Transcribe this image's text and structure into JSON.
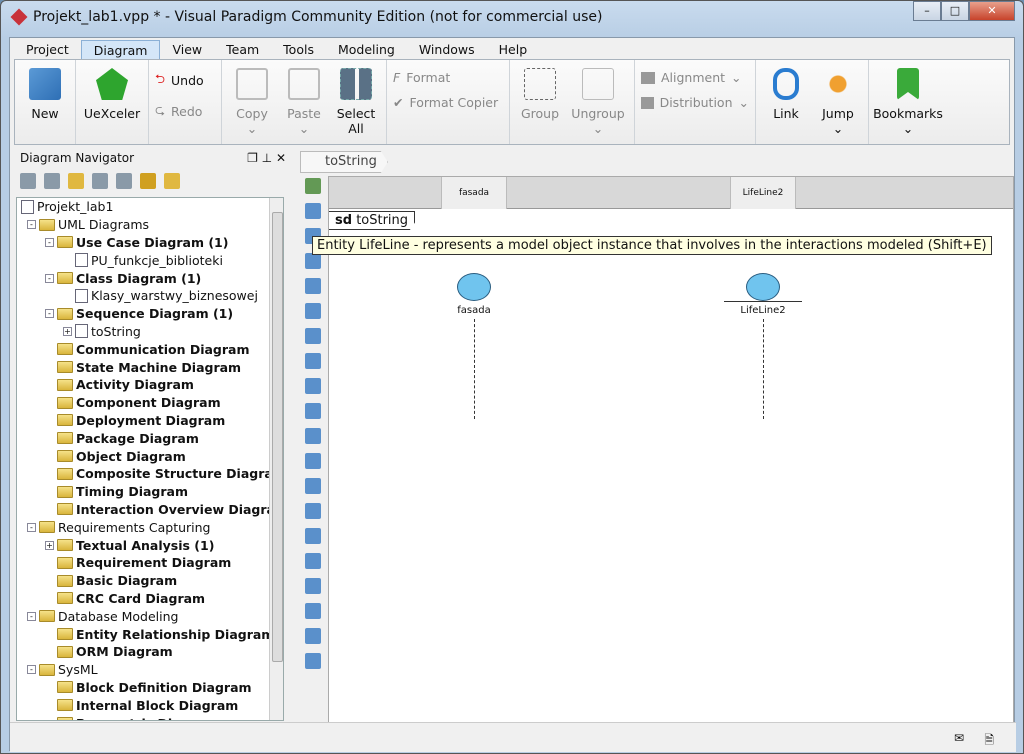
{
  "window": {
    "title": "Projekt_lab1.vpp * - Visual Paradigm Community Edition (not for commercial use)",
    "min": "–",
    "max": "□",
    "close": "✕"
  },
  "menu": [
    "Project",
    "Diagram",
    "View",
    "Team",
    "Tools",
    "Modeling",
    "Windows",
    "Help"
  ],
  "menu_active": "Diagram",
  "ribbon": {
    "new": "New",
    "uexceler": "UeXceler",
    "undo": "Undo",
    "redo": "Redo",
    "copy": "Copy",
    "paste": "Paste",
    "select_all": "Select All",
    "format": "Format",
    "format_copier": "Format Copier",
    "group": "Group",
    "ungroup": "Ungroup",
    "alignment": "Alignment",
    "distribution": "Distribution",
    "link": "Link",
    "jump": "Jump",
    "bookmarks": "Bookmarks"
  },
  "navigator": {
    "title": "Diagram Navigator",
    "tree": [
      {
        "label": "Projekt_lab1",
        "level": 0,
        "icon": "doc"
      },
      {
        "label": "UML Diagrams",
        "level": 1,
        "exp": "-"
      },
      {
        "label": "Use Case Diagram (1)",
        "level": 2,
        "bold": true,
        "exp": "-"
      },
      {
        "label": "PU_funkcje_biblioteki",
        "level": 3,
        "icon": "doc"
      },
      {
        "label": "Class Diagram (1)",
        "level": 2,
        "bold": true,
        "exp": "-"
      },
      {
        "label": "Klasy_warstwy_biznesowej",
        "level": 3,
        "icon": "doc"
      },
      {
        "label": "Sequence Diagram (1)",
        "level": 2,
        "bold": true,
        "exp": "-"
      },
      {
        "label": "toString",
        "level": 3,
        "icon": "doc",
        "exp": "+"
      },
      {
        "label": "Communication Diagram",
        "level": 2,
        "bold": true
      },
      {
        "label": "State Machine Diagram",
        "level": 2,
        "bold": true
      },
      {
        "label": "Activity Diagram",
        "level": 2,
        "bold": true
      },
      {
        "label": "Component Diagram",
        "level": 2,
        "bold": true
      },
      {
        "label": "Deployment Diagram",
        "level": 2,
        "bold": true
      },
      {
        "label": "Package Diagram",
        "level": 2,
        "bold": true
      },
      {
        "label": "Object Diagram",
        "level": 2,
        "bold": true
      },
      {
        "label": "Composite Structure Diagram",
        "level": 2,
        "bold": true
      },
      {
        "label": "Timing Diagram",
        "level": 2,
        "bold": true
      },
      {
        "label": "Interaction Overview Diagram",
        "level": 2,
        "bold": true
      },
      {
        "label": "Requirements Capturing",
        "level": 1,
        "exp": "-"
      },
      {
        "label": "Textual Analysis (1)",
        "level": 2,
        "bold": true,
        "exp": "+"
      },
      {
        "label": "Requirement Diagram",
        "level": 2,
        "bold": true
      },
      {
        "label": "Basic Diagram",
        "level": 2,
        "bold": true
      },
      {
        "label": "CRC Card Diagram",
        "level": 2,
        "bold": true
      },
      {
        "label": "Database Modeling",
        "level": 1,
        "exp": "-"
      },
      {
        "label": "Entity Relationship Diagram",
        "level": 2,
        "bold": true
      },
      {
        "label": "ORM Diagram",
        "level": 2,
        "bold": true
      },
      {
        "label": "SysML",
        "level": 1,
        "exp": "-"
      },
      {
        "label": "Block Definition Diagram",
        "level": 2,
        "bold": true
      },
      {
        "label": "Internal Block Diagram",
        "level": 2,
        "bold": true
      },
      {
        "label": "Parametric Diagram",
        "level": 2,
        "bold": true
      }
    ]
  },
  "diagram": {
    "breadcrumb": "toString",
    "frame_kw": "sd",
    "frame_name": "toString",
    "lifelines": [
      {
        "name": "fasada"
      },
      {
        "name": "LifeLine2"
      }
    ],
    "tooltip": "Entity LifeLine - represents a model object instance that involves in the interactions modeled (Shift+E)"
  }
}
